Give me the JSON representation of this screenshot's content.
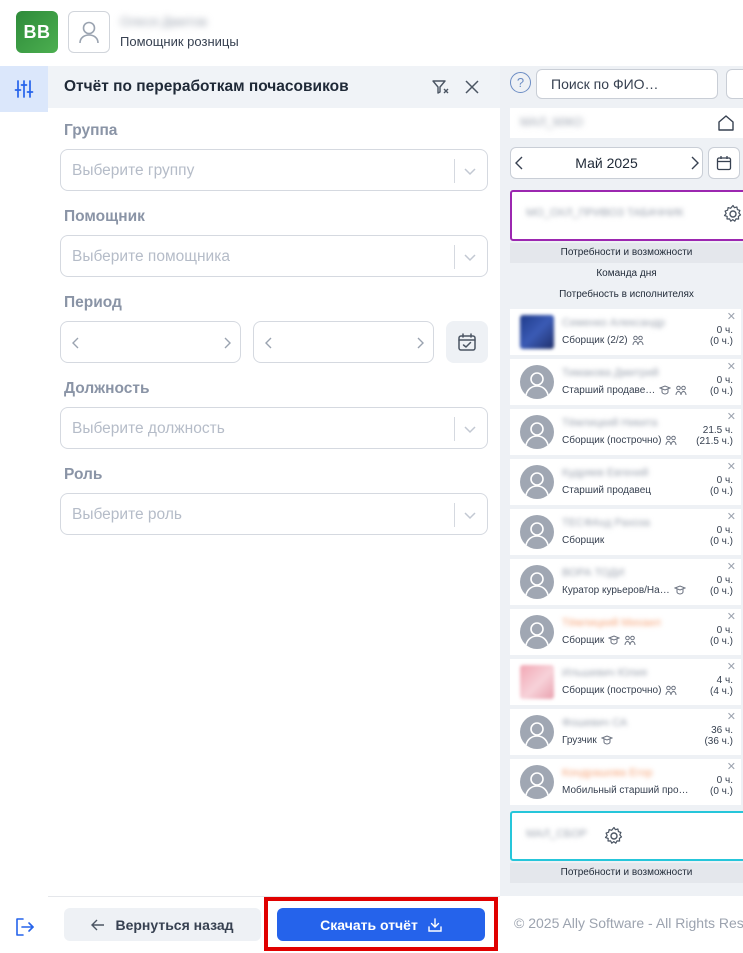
{
  "header": {
    "logo_text": "BB",
    "user_name": "Олеся Дмитов",
    "user_role": "Помощник розницы"
  },
  "panel": {
    "title": "Отчёт по переработкам почасовиков",
    "fields": [
      {
        "label": "Группа",
        "placeholder": "Выберите группу"
      },
      {
        "label": "Помощник",
        "placeholder": "Выберите помощника"
      },
      {
        "label": "Период",
        "placeholder": ""
      },
      {
        "label": "Должность",
        "placeholder": "Выберите должность"
      },
      {
        "label": "Роль",
        "placeholder": "Выберите роль"
      }
    ]
  },
  "footer": {
    "back_label": "Вернуться назад",
    "download_label": "Скачать отчёт",
    "copyright": "© 2025 Ally Software - All Rights Res"
  },
  "schedule": {
    "help_label": "?",
    "search_placeholder": "Поиск по ФИО…",
    "store_name": "МАЛ_МЖО",
    "month": "Май 2025",
    "dept1_name": "МО_ОХЛ_ПРИВОЗ ТАБАЧНИК",
    "strip_labels": [
      "Потребности и возможности",
      "Команда дня",
      "Потребность в исполнителях"
    ],
    "employees": [
      {
        "name": "Семенко Александр",
        "position": "Сборщик (2/2)",
        "hours": "0 ч.",
        "sub_hours": "(0 ч.)"
      },
      {
        "name": "Тимакова Дмитрий",
        "position": "Старший продаве…",
        "hours": "0 ч.",
        "sub_hours": "(0 ч.)"
      },
      {
        "name": "Тёмлицкий Никита",
        "position": "Сборщик (построчно)",
        "hours": "21.5 ч.",
        "sub_hours": "(21.5 ч.)"
      },
      {
        "name": "Кудряев Евгений",
        "position": "Старший продавец",
        "hours": "0 ч.",
        "sub_hours": "(0 ч.)"
      },
      {
        "name": "ТЕСФАхд Рахоза",
        "position": "Сборщик",
        "hours": "0 ч.",
        "sub_hours": "(0 ч.)"
      },
      {
        "name": "ВОРА ТОДИ",
        "position": "Куратор курьеров/На…",
        "hours": "0 ч.",
        "sub_hours": "(0 ч.)"
      },
      {
        "name": "Тёмлицкий Михаил",
        "position": "Сборщик",
        "hours": "0 ч.",
        "sub_hours": "(0 ч.)"
      },
      {
        "name": "Ильшевич Юлия",
        "position": "Сборщик (построчно)",
        "hours": "4 ч.",
        "sub_hours": "(4 ч.)"
      },
      {
        "name": "Фошевич СА",
        "position": "Грузчик",
        "hours": "36 ч.",
        "sub_hours": "(36 ч.)"
      },
      {
        "name": "Кондрашова Егор",
        "position": "Мобильный старший про…",
        "hours": "0 ч.",
        "sub_hours": "(0 ч.)"
      }
    ],
    "dept2_name": "МАЛ_СБОР",
    "dept2_strip": "Потребности и возможности"
  }
}
